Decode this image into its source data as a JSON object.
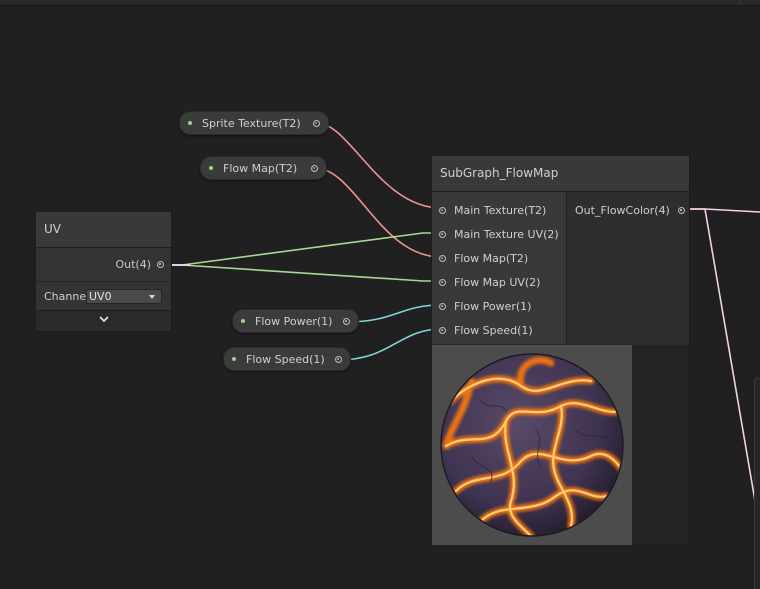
{
  "colors": {
    "background": "#202020",
    "texture_port": "#e87878",
    "vector2_port": "#9ad48c",
    "float_port": "#84d2da",
    "vector4_port": "#f0c8e8",
    "wire_texture": "#f0948c",
    "wire_vector2": "#a8d890",
    "wire_float": "#84d2da",
    "wire_vector4": "#f2d2ea"
  },
  "properties": [
    {
      "name": "sprite-texture-property",
      "label": "Sprite Texture(T2)",
      "port_type": "texture"
    },
    {
      "name": "flow-map-property",
      "label": "Flow Map(T2)",
      "port_type": "texture"
    },
    {
      "name": "flow-power-property",
      "label": "Flow Power(1)",
      "port_type": "float"
    },
    {
      "name": "flow-speed-property",
      "label": "Flow Speed(1)",
      "port_type": "float"
    }
  ],
  "uv_node": {
    "title": "UV",
    "output_label": "Out(4)",
    "channel_label": "Channel",
    "channel_value": "UV0",
    "expand_icon": "chevron-down-icon"
  },
  "subgraph_node": {
    "title": "SubGraph_FlowMap",
    "inputs": [
      {
        "label": "Main Texture(T2)",
        "port_type": "texture"
      },
      {
        "label": "Main Texture UV(2)",
        "port_type": "vector2"
      },
      {
        "label": "Flow Map(T2)",
        "port_type": "texture"
      },
      {
        "label": "Flow Map UV(2)",
        "port_type": "vector2"
      },
      {
        "label": "Flow Power(1)",
        "port_type": "float"
      },
      {
        "label": "Flow Speed(1)",
        "port_type": "float"
      }
    ],
    "output_label": "Out_FlowColor(4)",
    "preview": "lava-flow-sphere-preview"
  }
}
